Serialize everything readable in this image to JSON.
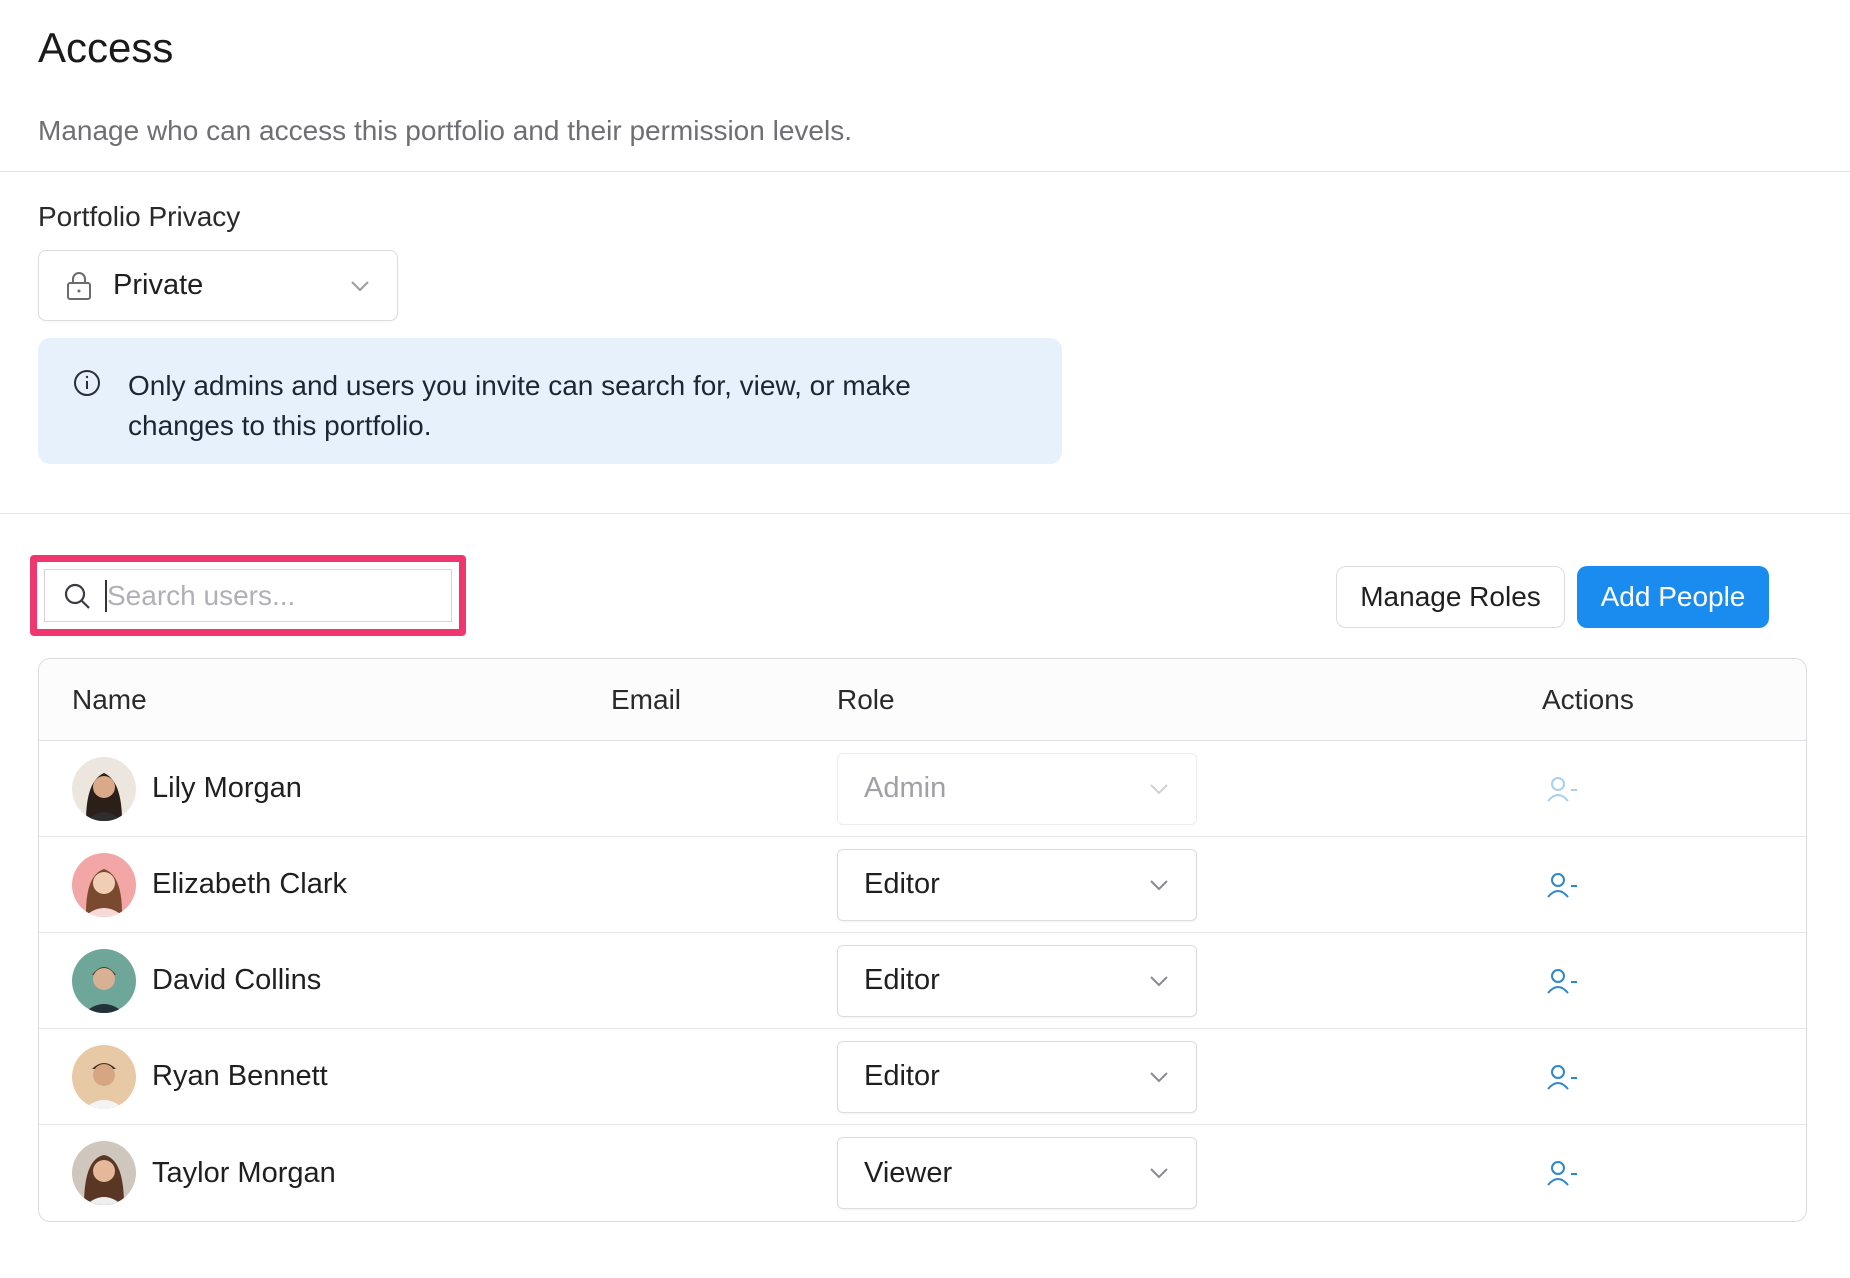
{
  "header": {
    "title": "Access",
    "subtitle": "Manage who can access this portfolio and their permission levels."
  },
  "privacy": {
    "label": "Portfolio Privacy",
    "value": "Private",
    "icon": "lock-icon",
    "info_icon": "info-icon",
    "info_text": "Only admins and users you invite can search for, view, or make changes to this portfolio."
  },
  "toolbar": {
    "search_placeholder": "Search users...",
    "search_value": "",
    "highlight_color": "#f0366f",
    "manage_roles_label": "Manage Roles",
    "add_people_label": "Add People",
    "accent_color": "#1a8cf0"
  },
  "table": {
    "columns": [
      "Name",
      "Email",
      "Role",
      "Actions"
    ],
    "rows": [
      {
        "name": "Lily Morgan",
        "email": "",
        "role": "Admin",
        "role_disabled": true,
        "action_icon": "remove-user-icon"
      },
      {
        "name": "Elizabeth Clark",
        "email": "",
        "role": "Editor",
        "role_disabled": false,
        "action_icon": "remove-user-icon"
      },
      {
        "name": "David Collins",
        "email": "",
        "role": "Editor",
        "role_disabled": false,
        "action_icon": "remove-user-icon"
      },
      {
        "name": "Ryan Bennett",
        "email": "",
        "role": "Editor",
        "role_disabled": false,
        "action_icon": "remove-user-icon"
      },
      {
        "name": "Taylor Morgan",
        "email": "",
        "role": "Viewer",
        "role_disabled": false,
        "action_icon": "remove-user-icon"
      }
    ]
  }
}
